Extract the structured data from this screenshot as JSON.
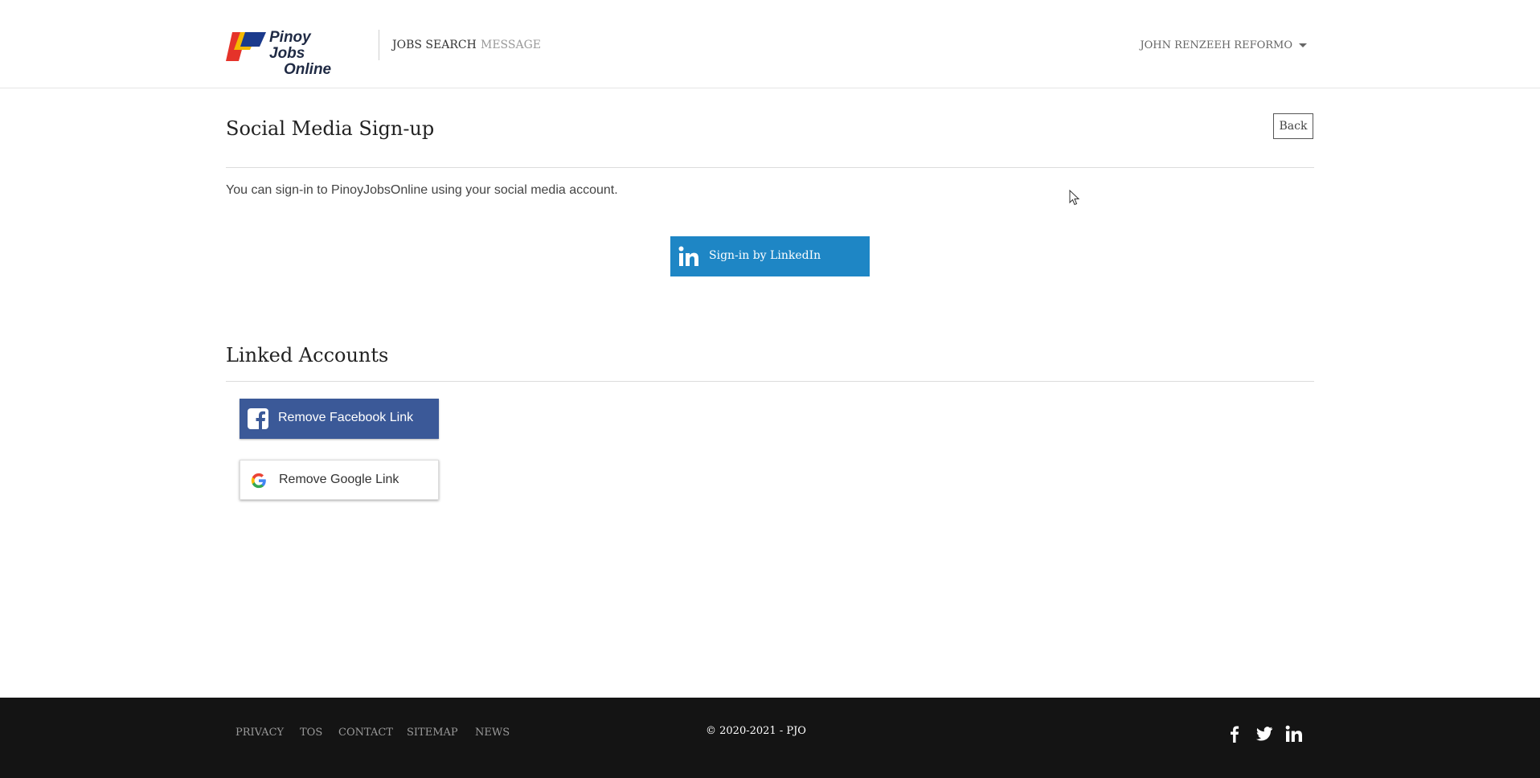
{
  "brand": {
    "logo_text_line1": "Pinoy Jobs",
    "logo_text_line2": "Online",
    "logo_colors": [
      "#1b3a8c",
      "#e5332a",
      "#f5b800"
    ]
  },
  "nav": {
    "items": [
      {
        "label": "JOBS SEARCH"
      },
      {
        "label": "MESSAGE"
      }
    ],
    "user_name": "JOHN RENZEEH REFORMO"
  },
  "page": {
    "title": "Social Media Sign-up",
    "back_label": "Back",
    "description": "You can sign-in to PinoyJobsOnline using your social media account."
  },
  "linkedin_button": {
    "label": "Sign-in by LinkedIn",
    "icon": "linkedin-icon",
    "color": "#1e86c5"
  },
  "linked_accounts": {
    "title": "Linked Accounts",
    "facebook": {
      "label": "Remove Facebook Link",
      "icon": "facebook-icon",
      "color": "#3b5998"
    },
    "google": {
      "label": "Remove Google Link",
      "icon": "google-icon"
    }
  },
  "footer": {
    "links": [
      {
        "label": "PRIVACY"
      },
      {
        "label": "TOS"
      },
      {
        "label": "CONTACT"
      },
      {
        "label": "SITEMAP"
      },
      {
        "label": "NEWS"
      }
    ],
    "copyright": "© 2020-2021 - PJO",
    "social_icons": [
      "facebook-icon",
      "twitter-icon",
      "linkedin-icon"
    ],
    "background": "#141414"
  }
}
